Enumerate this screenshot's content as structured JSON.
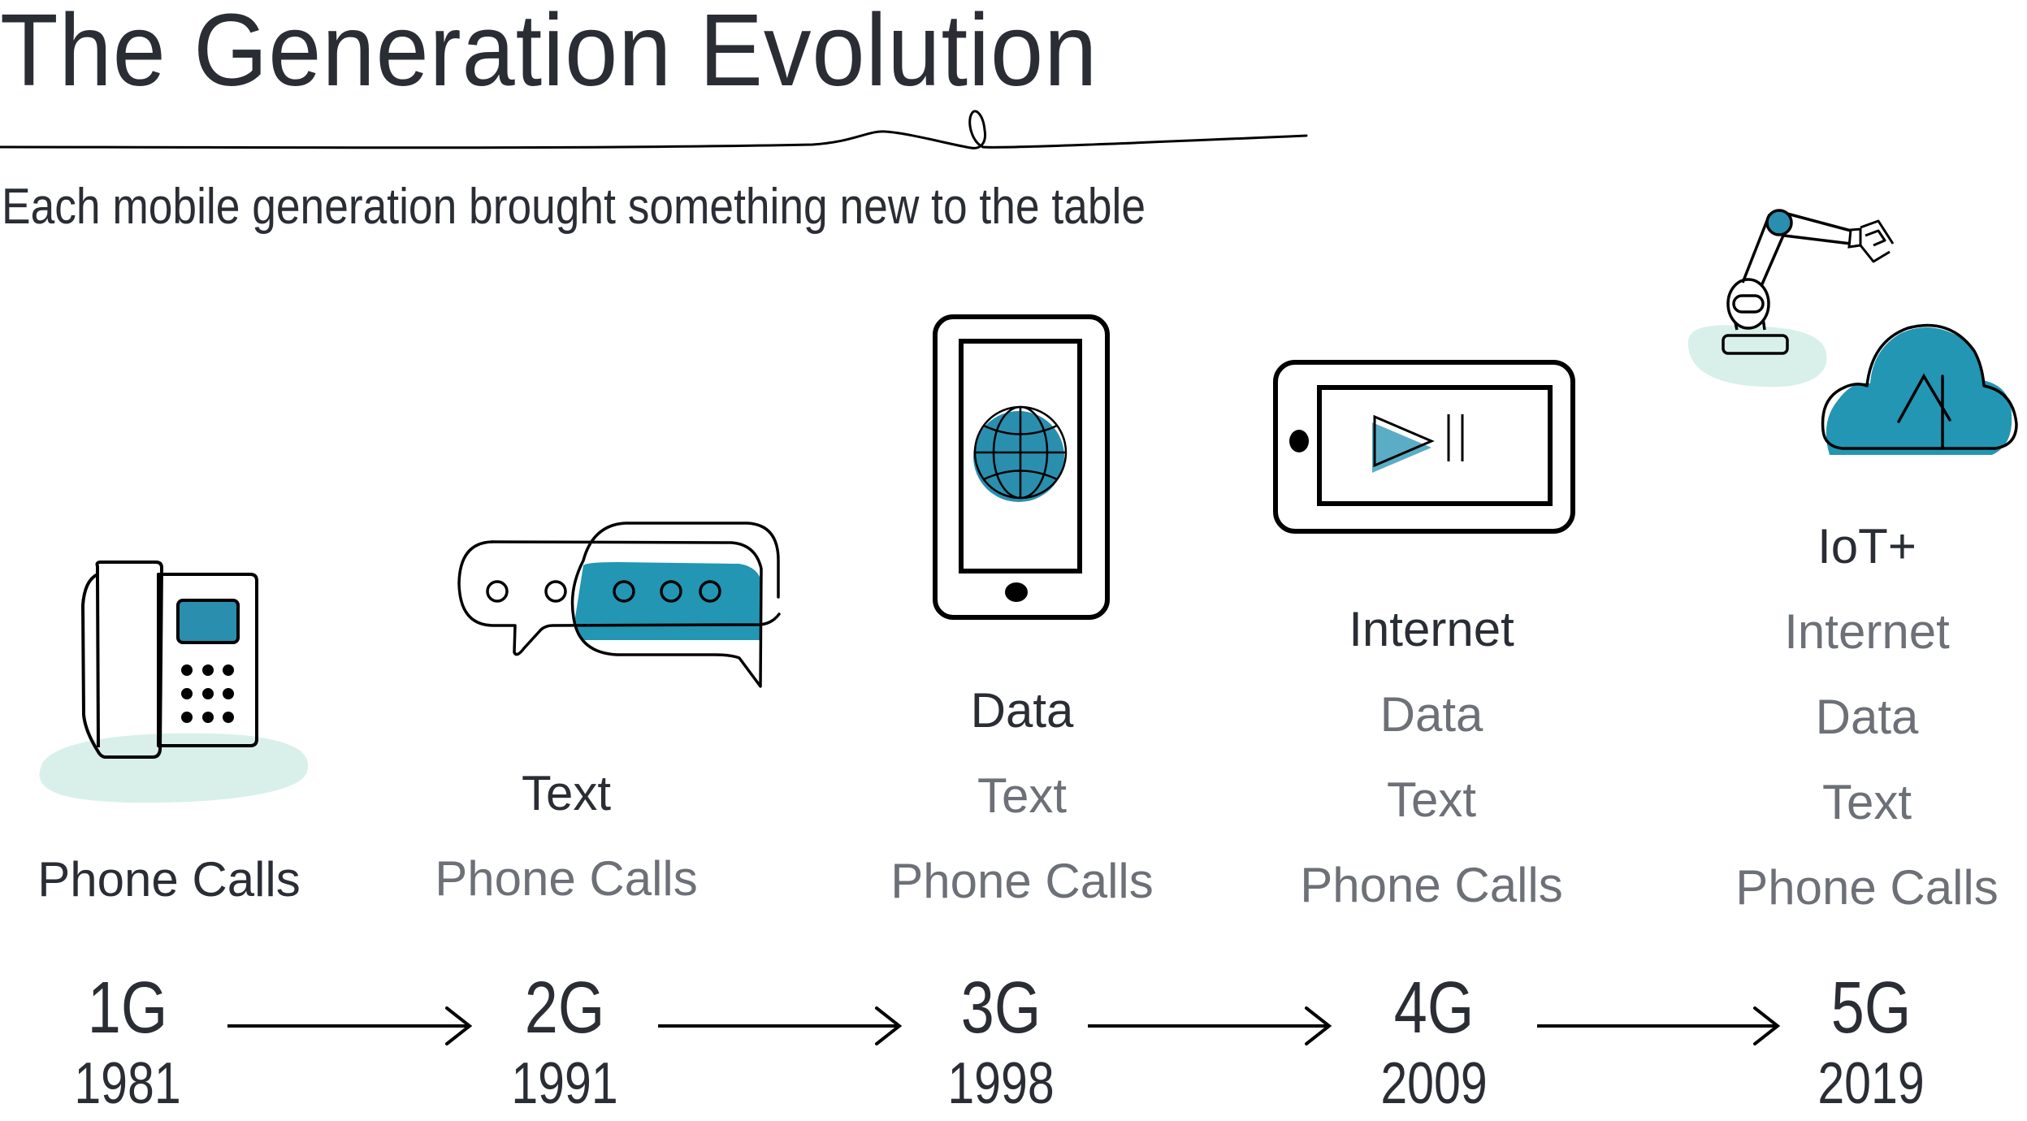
{
  "header": {
    "title": "The Generation Evolution",
    "subtitle": "Each mobile generation brought something new to the table"
  },
  "colors": {
    "text_primary": "#2a2d34",
    "text_secondary": "#6d7077",
    "accent_teal": "#2396b4",
    "accent_blue": "#2a8fae",
    "shadow_mint": "#d9f0ea",
    "stroke": "#000000"
  },
  "generations": [
    {
      "gen": "1G",
      "year": "1981",
      "icon": "desk-phone-icon",
      "features": [
        {
          "label": "Phone Calls",
          "state": "current"
        }
      ]
    },
    {
      "gen": "2G",
      "year": "1991",
      "icon": "chat-bubbles-icon",
      "features": [
        {
          "label": "Text",
          "state": "current"
        },
        {
          "label": "Phone Calls",
          "state": "past"
        }
      ]
    },
    {
      "gen": "3G",
      "year": "1998",
      "icon": "smartphone-globe-icon",
      "features": [
        {
          "label": "Data",
          "state": "current"
        },
        {
          "label": "Text",
          "state": "past"
        },
        {
          "label": "Phone Calls",
          "state": "past"
        }
      ]
    },
    {
      "gen": "4G",
      "year": "2009",
      "icon": "tablet-video-icon",
      "features": [
        {
          "label": "Internet",
          "state": "current"
        },
        {
          "label": "Data",
          "state": "past"
        },
        {
          "label": "Text",
          "state": "past"
        },
        {
          "label": "Phone Calls",
          "state": "past"
        }
      ]
    },
    {
      "gen": "5G",
      "year": "2019",
      "icon": "robot-arm-cloud-icon",
      "features": [
        {
          "label": "IoT+",
          "state": "current"
        },
        {
          "label": "Internet",
          "state": "past"
        },
        {
          "label": "Data",
          "state": "past"
        },
        {
          "label": "Text",
          "state": "past"
        },
        {
          "label": "Phone Calls",
          "state": "past"
        }
      ]
    }
  ]
}
